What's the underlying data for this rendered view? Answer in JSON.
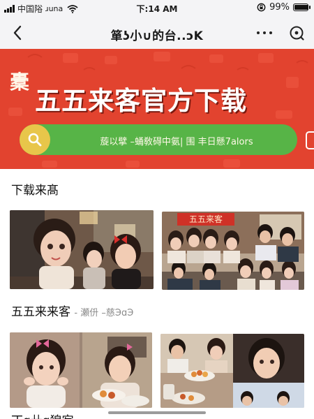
{
  "status_bar": {
    "carrier": "中国䧍",
    "network": "ɹuna",
    "time": "下:14 AM",
    "battery_text": "99%",
    "battery_level": 0.99,
    "icons": [
      "signal-icon",
      "wifi-icon",
      "orientation-lock-icon",
      "battery-icon"
    ]
  },
  "nav_bar": {
    "title": "箪ʖ小∪的台..ɔK",
    "icons": [
      "back-arrow-icon",
      "more-dots-icon",
      "target-icon"
    ]
  },
  "hero": {
    "seal": "橐",
    "title": "五五来客官方下载",
    "search_text": "蔙以擘 –蛹敎碍中氨| 围 丰日懸7alors",
    "colors": {
      "background": "#e2432f",
      "search": "#57b447",
      "search_button": "#e8c64a"
    }
  },
  "sections": [
    {
      "title": "下载来髙",
      "subtitle": ""
    },
    {
      "title": "五五来来客",
      "subtitle": "- 瀬㐼 –慈ЭɑЭ"
    },
    {
      "title": "丁ɑ卄ɑ㹸㝍",
      "subtitle": ""
    }
  ],
  "photos": [
    {
      "label": ""
    },
    {
      "label": "五五来客"
    },
    {
      "label": ""
    },
    {
      "label": ""
    }
  ]
}
